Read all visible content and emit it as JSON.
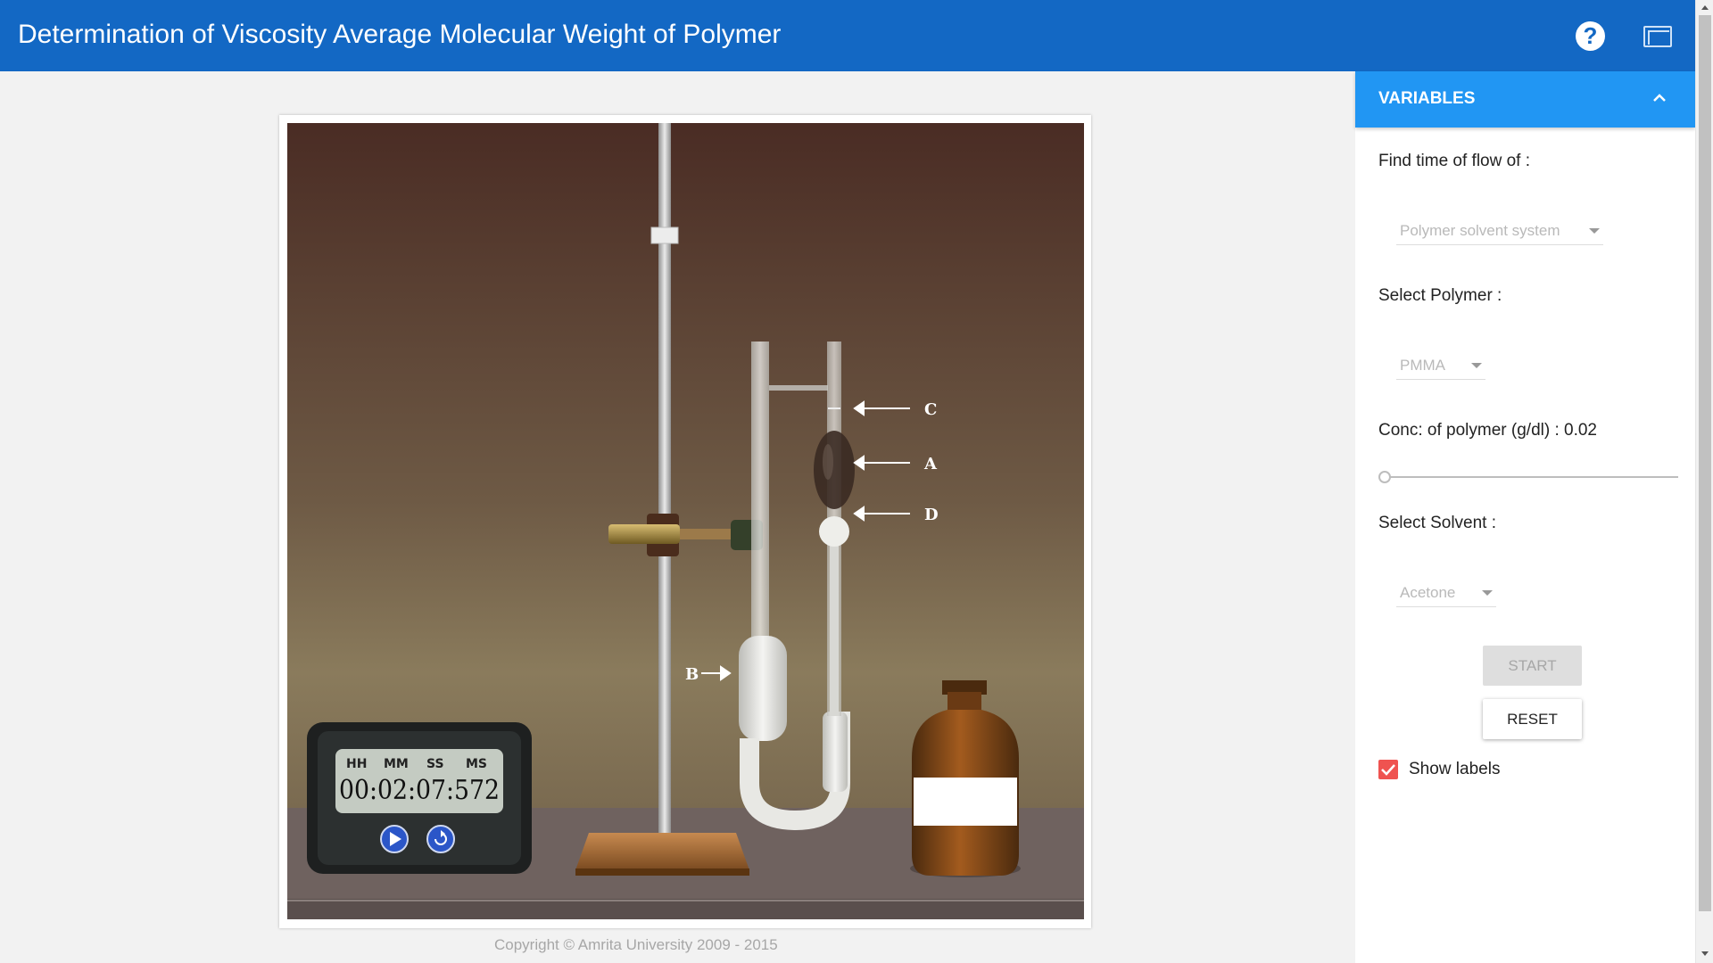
{
  "header": {
    "title": "Determination of Viscosity Average Molecular Weight of Polymer",
    "help_icon": "?",
    "colors": {
      "bar": "#1368c4"
    }
  },
  "simulation": {
    "labels": {
      "a": "A",
      "b": "B",
      "c": "C",
      "d": "D"
    },
    "timer": {
      "headers": [
        "HH",
        "MM",
        "SS",
        "MS"
      ],
      "display": "00:02:07:572",
      "play_icon": "play-icon",
      "reset_icon": "refresh-icon"
    },
    "copyright": "Copyright © Amrita University 2009 - 2015"
  },
  "panel": {
    "header": "VARIABLES",
    "find_time_label": "Find time of flow of :",
    "find_time_value": "Polymer solvent system",
    "polymer_label": "Select Polymer :",
    "polymer_value": "PMMA",
    "conc_label": "Conc: of polymer (g/dl) : 0.02",
    "conc_value": 0.02,
    "conc_slider_fraction": 0.0,
    "solvent_label": "Select Solvent :",
    "solvent_value": "Acetone",
    "start_label": "START",
    "reset_label": "RESET",
    "show_labels_label": "Show labels",
    "show_labels_checked": true,
    "colors": {
      "header": "#2196f3",
      "checkbox": "#ef5350"
    }
  }
}
